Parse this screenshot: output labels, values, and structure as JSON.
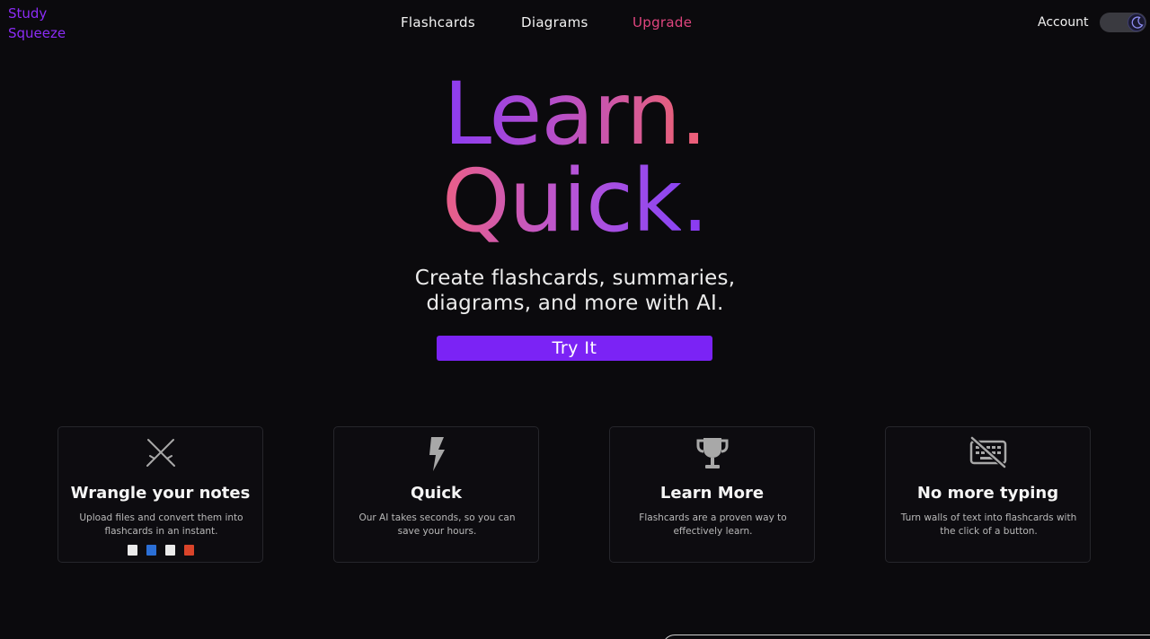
{
  "logo": {
    "line1": "Study",
    "line2": "Squeeze"
  },
  "nav": {
    "flashcards": "Flashcards",
    "diagrams": "Diagrams",
    "upgrade": "Upgrade"
  },
  "account": {
    "label": "Account",
    "theme_toggle_state": "dark"
  },
  "hero": {
    "line1": "Learn",
    "line1_dot": ".",
    "line2": "Quick",
    "line2_dot": ".",
    "subtitle_line1": "Create flashcards, summaries,",
    "subtitle_line2": "diagrams, and more with AI.",
    "cta": "Try It"
  },
  "features": [
    {
      "icon": "fencing-swords-icon",
      "title": "Wrangle your notes",
      "desc": "Upload files and convert them into flashcards in an instant.",
      "file_icons": [
        "pdf-file-icon",
        "word-file-icon",
        "image-file-icon",
        "powerpoint-file-icon"
      ]
    },
    {
      "icon": "lightning-icon",
      "title": "Quick",
      "desc": "Our AI takes seconds, so you can save your hours."
    },
    {
      "icon": "trophy-icon",
      "title": "Learn More",
      "desc": "Flashcards are a proven way to effectively learn."
    },
    {
      "icon": "keyboard-off-icon",
      "title": "No more typing",
      "desc": "Turn walls of text into flashcards with the click of a button."
    }
  ],
  "colors": {
    "accent": "#7b23f5",
    "upgrade": "#e0457f",
    "logo": "#8b2cf5",
    "background": "#0b0a0d"
  }
}
